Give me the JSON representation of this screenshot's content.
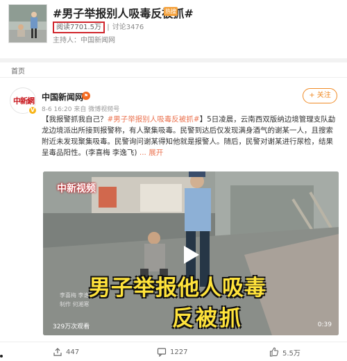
{
  "topic": {
    "title": "#男子举报别人吸毒反被抓#",
    "badge": "热搜",
    "reads": "阅读7701.5万",
    "discussions": "讨论3476",
    "stat_separator": "|",
    "host": "主持人：中国新闻网"
  },
  "tabs": {
    "home": "首页"
  },
  "post": {
    "avatar_text": "中新網",
    "verified_mark": "V",
    "author": "中国新闻网",
    "author_badge_mark": "⚑",
    "meta": "8-6 16:20 来自 微博视频号",
    "follow_label": "+ 关注",
    "text_prefix": "【我报警抓我自己？",
    "text_topic": "#男子举报别人吸毒反被抓#",
    "text_body": "】5日凌晨，云南西双版纳边境管理支队勐龙边境派出所接到报警称，有人聚集吸毒。民警到达后仅发现满身酒气的谢某一人，且搜索附近未发现聚集吸毒。民警询问谢某得知他就是报警人。随后，民警对谢某进行尿检，结果呈毒品阳性。(李喜梅 李逸飞)",
    "more_label": "... 展开"
  },
  "video": {
    "logo": "中新视频",
    "caption_line1_a": "男子举报",
    "caption_line1_b": "他人吸毒",
    "caption_line2": "反被抓",
    "credit_1": "李喜梅 李逸飞",
    "credit_2": "制作 何湘寒",
    "views": "329万次观看",
    "duration": "0:39"
  },
  "actions": {
    "share_count": "447",
    "comment_count": "1227",
    "like_count": "5.5万"
  },
  "colors": {
    "accent": "#eb7350",
    "highlight_box": "#d0242b",
    "brand_red": "#c8161d",
    "caption_yellow": "#ffe33b"
  },
  "icons": [
    "play-icon",
    "share-icon",
    "comment-icon",
    "like-icon",
    "verified-icon"
  ]
}
